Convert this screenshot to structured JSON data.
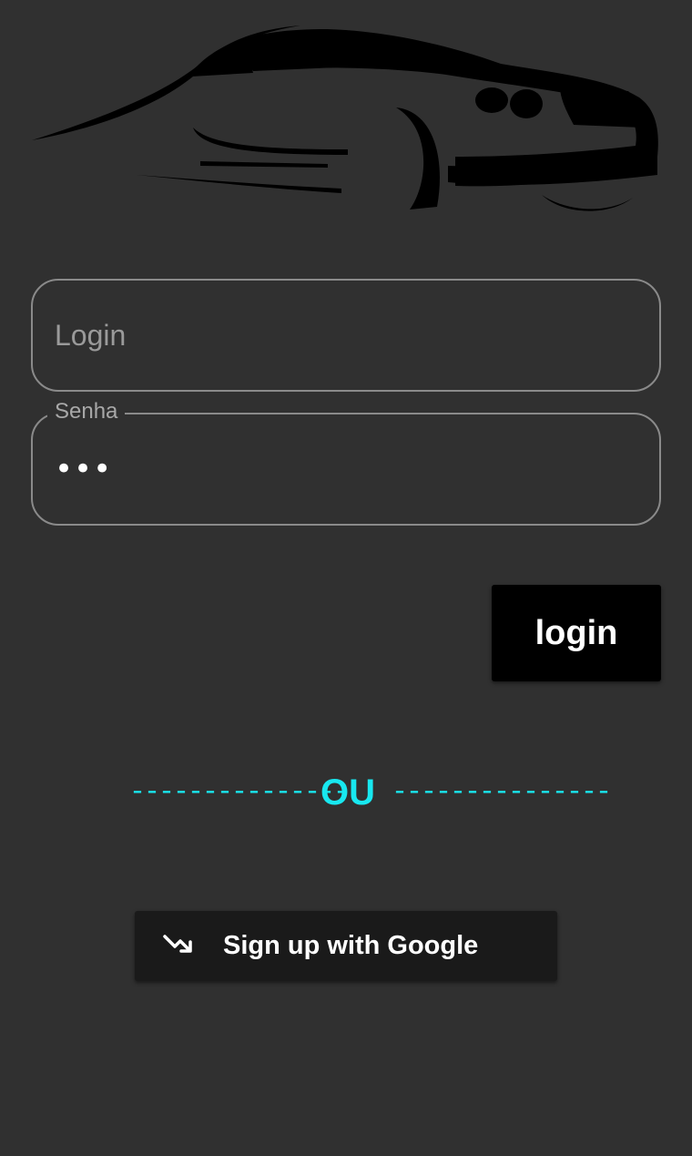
{
  "logo": {
    "icon": "car-silhouette-icon"
  },
  "login_field": {
    "placeholder": "Login",
    "value": ""
  },
  "password_field": {
    "label": "Senha",
    "masked_value": "•••"
  },
  "login_button": {
    "label": "login"
  },
  "divider": {
    "left": "---------------",
    "text": "OU",
    "right": "---------------",
    "color": "#18e8f0"
  },
  "google_button": {
    "label": "Sign up with Google",
    "icon": "trending-up-arrow-icon"
  },
  "colors": {
    "background": "#303030",
    "button": "#000000",
    "google_button": "#1a1a1a",
    "accent": "#18e8f0"
  }
}
